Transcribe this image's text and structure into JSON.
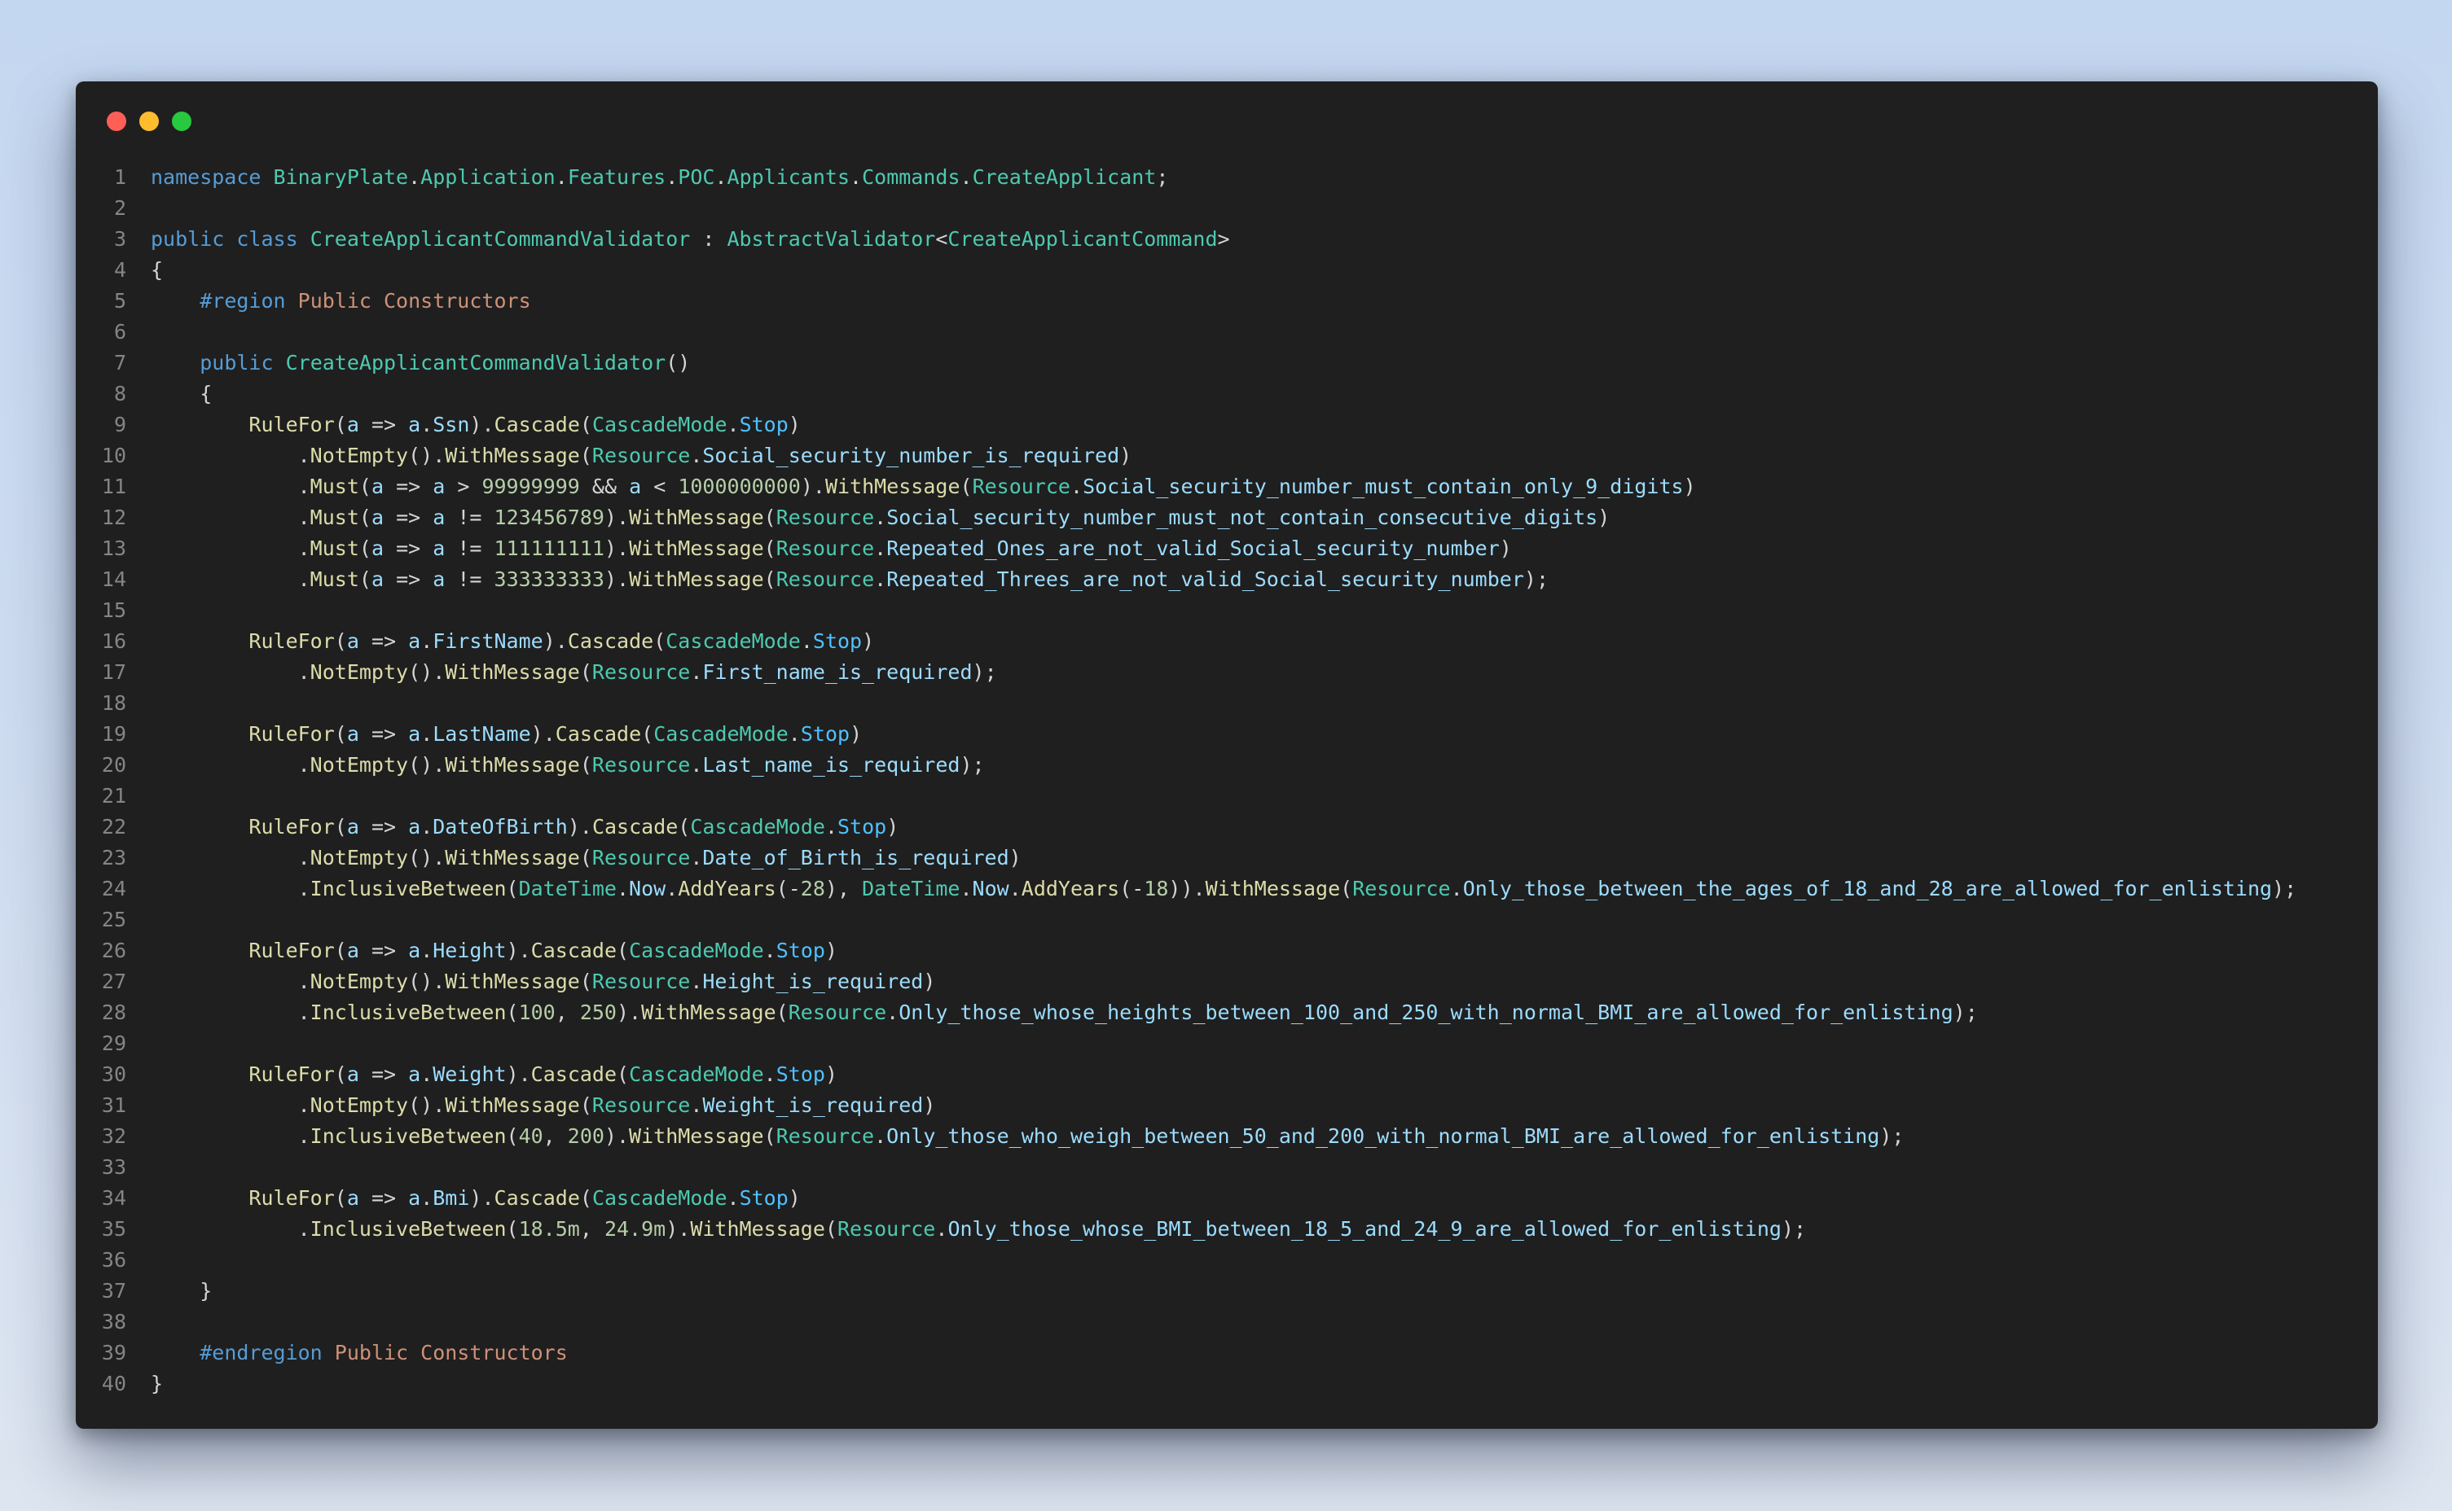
{
  "window": {
    "controls": [
      "close",
      "minimize",
      "maximize"
    ],
    "colors": {
      "background": "#1f1f1f",
      "keyword": "#569cd6",
      "type": "#4ec9b0",
      "method": "#dcdcaa",
      "property": "#9cdcfe",
      "enum_member": "#4fc1ff",
      "number": "#b5cea8",
      "region_text": "#ce9178",
      "line_number": "#858585"
    }
  },
  "code": {
    "language": "csharp",
    "lines": [
      [
        [
          "kw",
          "namespace"
        ],
        [
          "p",
          " "
        ],
        [
          "t",
          "BinaryPlate"
        ],
        [
          "p",
          "."
        ],
        [
          "t",
          "Application"
        ],
        [
          "p",
          "."
        ],
        [
          "t",
          "Features"
        ],
        [
          "p",
          "."
        ],
        [
          "t",
          "POC"
        ],
        [
          "p",
          "."
        ],
        [
          "t",
          "Applicants"
        ],
        [
          "p",
          "."
        ],
        [
          "t",
          "Commands"
        ],
        [
          "p",
          "."
        ],
        [
          "t",
          "CreateApplicant"
        ],
        [
          "p",
          ";"
        ]
      ],
      [],
      [
        [
          "kw",
          "public"
        ],
        [
          "p",
          " "
        ],
        [
          "kw",
          "class"
        ],
        [
          "p",
          " "
        ],
        [
          "t",
          "CreateApplicantCommandValidator"
        ],
        [
          "p",
          " : "
        ],
        [
          "t",
          "AbstractValidator"
        ],
        [
          "p",
          "<"
        ],
        [
          "t",
          "CreateApplicantCommand"
        ],
        [
          "p",
          ">"
        ]
      ],
      [
        [
          "p",
          "{"
        ]
      ],
      [
        [
          "p",
          "    "
        ],
        [
          "kw",
          "#region"
        ],
        [
          "p",
          " "
        ],
        [
          "r",
          "Public Constructors"
        ]
      ],
      [],
      [
        [
          "p",
          "    "
        ],
        [
          "kw",
          "public"
        ],
        [
          "p",
          " "
        ],
        [
          "t",
          "CreateApplicantCommandValidator"
        ],
        [
          "p",
          "()"
        ]
      ],
      [
        [
          "p",
          "    {"
        ]
      ],
      [
        [
          "p",
          "        "
        ],
        [
          "m",
          "RuleFor"
        ],
        [
          "p",
          "("
        ],
        [
          "pr",
          "a"
        ],
        [
          "p",
          " => "
        ],
        [
          "pr",
          "a"
        ],
        [
          "p",
          "."
        ],
        [
          "pr",
          "Ssn"
        ],
        [
          "p",
          ")."
        ],
        [
          "m",
          "Cascade"
        ],
        [
          "p",
          "("
        ],
        [
          "t",
          "CascadeMode"
        ],
        [
          "p",
          "."
        ],
        [
          "e",
          "Stop"
        ],
        [
          "p",
          ")"
        ]
      ],
      [
        [
          "p",
          "            ."
        ],
        [
          "m",
          "NotEmpty"
        ],
        [
          "p",
          "()."
        ],
        [
          "m",
          "WithMessage"
        ],
        [
          "p",
          "("
        ],
        [
          "t",
          "Resource"
        ],
        [
          "p",
          "."
        ],
        [
          "pr",
          "Social_security_number_is_required"
        ],
        [
          "p",
          ")"
        ]
      ],
      [
        [
          "p",
          "            ."
        ],
        [
          "m",
          "Must"
        ],
        [
          "p",
          "("
        ],
        [
          "pr",
          "a"
        ],
        [
          "p",
          " => "
        ],
        [
          "pr",
          "a"
        ],
        [
          "p",
          " > "
        ],
        [
          "n",
          "99999999"
        ],
        [
          "p",
          " && "
        ],
        [
          "pr",
          "a"
        ],
        [
          "p",
          " < "
        ],
        [
          "n",
          "1000000000"
        ],
        [
          "p",
          ")."
        ],
        [
          "m",
          "WithMessage"
        ],
        [
          "p",
          "("
        ],
        [
          "t",
          "Resource"
        ],
        [
          "p",
          "."
        ],
        [
          "pr",
          "Social_security_number_must_contain_only_9_digits"
        ],
        [
          "p",
          ")"
        ]
      ],
      [
        [
          "p",
          "            ."
        ],
        [
          "m",
          "Must"
        ],
        [
          "p",
          "("
        ],
        [
          "pr",
          "a"
        ],
        [
          "p",
          " => "
        ],
        [
          "pr",
          "a"
        ],
        [
          "p",
          " != "
        ],
        [
          "n",
          "123456789"
        ],
        [
          "p",
          ")."
        ],
        [
          "m",
          "WithMessage"
        ],
        [
          "p",
          "("
        ],
        [
          "t",
          "Resource"
        ],
        [
          "p",
          "."
        ],
        [
          "pr",
          "Social_security_number_must_not_contain_consecutive_digits"
        ],
        [
          "p",
          ")"
        ]
      ],
      [
        [
          "p",
          "            ."
        ],
        [
          "m",
          "Must"
        ],
        [
          "p",
          "("
        ],
        [
          "pr",
          "a"
        ],
        [
          "p",
          " => "
        ],
        [
          "pr",
          "a"
        ],
        [
          "p",
          " != "
        ],
        [
          "n",
          "111111111"
        ],
        [
          "p",
          ")."
        ],
        [
          "m",
          "WithMessage"
        ],
        [
          "p",
          "("
        ],
        [
          "t",
          "Resource"
        ],
        [
          "p",
          "."
        ],
        [
          "pr",
          "Repeated_Ones_are_not_valid_Social_security_number"
        ],
        [
          "p",
          ")"
        ]
      ],
      [
        [
          "p",
          "            ."
        ],
        [
          "m",
          "Must"
        ],
        [
          "p",
          "("
        ],
        [
          "pr",
          "a"
        ],
        [
          "p",
          " => "
        ],
        [
          "pr",
          "a"
        ],
        [
          "p",
          " != "
        ],
        [
          "n",
          "333333333"
        ],
        [
          "p",
          ")."
        ],
        [
          "m",
          "WithMessage"
        ],
        [
          "p",
          "("
        ],
        [
          "t",
          "Resource"
        ],
        [
          "p",
          "."
        ],
        [
          "pr",
          "Repeated_Threes_are_not_valid_Social_security_number"
        ],
        [
          "p",
          ");"
        ]
      ],
      [],
      [
        [
          "p",
          "        "
        ],
        [
          "m",
          "RuleFor"
        ],
        [
          "p",
          "("
        ],
        [
          "pr",
          "a"
        ],
        [
          "p",
          " => "
        ],
        [
          "pr",
          "a"
        ],
        [
          "p",
          "."
        ],
        [
          "pr",
          "FirstName"
        ],
        [
          "p",
          ")."
        ],
        [
          "m",
          "Cascade"
        ],
        [
          "p",
          "("
        ],
        [
          "t",
          "CascadeMode"
        ],
        [
          "p",
          "."
        ],
        [
          "e",
          "Stop"
        ],
        [
          "p",
          ")"
        ]
      ],
      [
        [
          "p",
          "            ."
        ],
        [
          "m",
          "NotEmpty"
        ],
        [
          "p",
          "()."
        ],
        [
          "m",
          "WithMessage"
        ],
        [
          "p",
          "("
        ],
        [
          "t",
          "Resource"
        ],
        [
          "p",
          "."
        ],
        [
          "pr",
          "First_name_is_required"
        ],
        [
          "p",
          ");"
        ]
      ],
      [],
      [
        [
          "p",
          "        "
        ],
        [
          "m",
          "RuleFor"
        ],
        [
          "p",
          "("
        ],
        [
          "pr",
          "a"
        ],
        [
          "p",
          " => "
        ],
        [
          "pr",
          "a"
        ],
        [
          "p",
          "."
        ],
        [
          "pr",
          "LastName"
        ],
        [
          "p",
          ")."
        ],
        [
          "m",
          "Cascade"
        ],
        [
          "p",
          "("
        ],
        [
          "t",
          "CascadeMode"
        ],
        [
          "p",
          "."
        ],
        [
          "e",
          "Stop"
        ],
        [
          "p",
          ")"
        ]
      ],
      [
        [
          "p",
          "            ."
        ],
        [
          "m",
          "NotEmpty"
        ],
        [
          "p",
          "()."
        ],
        [
          "m",
          "WithMessage"
        ],
        [
          "p",
          "("
        ],
        [
          "t",
          "Resource"
        ],
        [
          "p",
          "."
        ],
        [
          "pr",
          "Last_name_is_required"
        ],
        [
          "p",
          ");"
        ]
      ],
      [],
      [
        [
          "p",
          "        "
        ],
        [
          "m",
          "RuleFor"
        ],
        [
          "p",
          "("
        ],
        [
          "pr",
          "a"
        ],
        [
          "p",
          " => "
        ],
        [
          "pr",
          "a"
        ],
        [
          "p",
          "."
        ],
        [
          "pr",
          "DateOfBirth"
        ],
        [
          "p",
          ")."
        ],
        [
          "m",
          "Cascade"
        ],
        [
          "p",
          "("
        ],
        [
          "t",
          "CascadeMode"
        ],
        [
          "p",
          "."
        ],
        [
          "e",
          "Stop"
        ],
        [
          "p",
          ")"
        ]
      ],
      [
        [
          "p",
          "            ."
        ],
        [
          "m",
          "NotEmpty"
        ],
        [
          "p",
          "()."
        ],
        [
          "m",
          "WithMessage"
        ],
        [
          "p",
          "("
        ],
        [
          "t",
          "Resource"
        ],
        [
          "p",
          "."
        ],
        [
          "pr",
          "Date_of_Birth_is_required"
        ],
        [
          "p",
          ")"
        ]
      ],
      [
        [
          "p",
          "            ."
        ],
        [
          "m",
          "InclusiveBetween"
        ],
        [
          "p",
          "("
        ],
        [
          "t",
          "DateTime"
        ],
        [
          "p",
          "."
        ],
        [
          "pr",
          "Now"
        ],
        [
          "p",
          "."
        ],
        [
          "m",
          "AddYears"
        ],
        [
          "p",
          "(-"
        ],
        [
          "n",
          "28"
        ],
        [
          "p",
          "), "
        ],
        [
          "t",
          "DateTime"
        ],
        [
          "p",
          "."
        ],
        [
          "pr",
          "Now"
        ],
        [
          "p",
          "."
        ],
        [
          "m",
          "AddYears"
        ],
        [
          "p",
          "(-"
        ],
        [
          "n",
          "18"
        ],
        [
          "p",
          "))."
        ],
        [
          "m",
          "WithMessage"
        ],
        [
          "p",
          "("
        ],
        [
          "t",
          "Resource"
        ],
        [
          "p",
          "."
        ],
        [
          "pr",
          "Only_those_between_the_ages_of_18_and_28_are_allowed_for_enlisting"
        ],
        [
          "p",
          ");"
        ]
      ],
      [],
      [
        [
          "p",
          "        "
        ],
        [
          "m",
          "RuleFor"
        ],
        [
          "p",
          "("
        ],
        [
          "pr",
          "a"
        ],
        [
          "p",
          " => "
        ],
        [
          "pr",
          "a"
        ],
        [
          "p",
          "."
        ],
        [
          "pr",
          "Height"
        ],
        [
          "p",
          ")."
        ],
        [
          "m",
          "Cascade"
        ],
        [
          "p",
          "("
        ],
        [
          "t",
          "CascadeMode"
        ],
        [
          "p",
          "."
        ],
        [
          "e",
          "Stop"
        ],
        [
          "p",
          ")"
        ]
      ],
      [
        [
          "p",
          "            ."
        ],
        [
          "m",
          "NotEmpty"
        ],
        [
          "p",
          "()."
        ],
        [
          "m",
          "WithMessage"
        ],
        [
          "p",
          "("
        ],
        [
          "t",
          "Resource"
        ],
        [
          "p",
          "."
        ],
        [
          "pr",
          "Height_is_required"
        ],
        [
          "p",
          ")"
        ]
      ],
      [
        [
          "p",
          "            ."
        ],
        [
          "m",
          "InclusiveBetween"
        ],
        [
          "p",
          "("
        ],
        [
          "n",
          "100"
        ],
        [
          "p",
          ", "
        ],
        [
          "n",
          "250"
        ],
        [
          "p",
          ")."
        ],
        [
          "m",
          "WithMessage"
        ],
        [
          "p",
          "("
        ],
        [
          "t",
          "Resource"
        ],
        [
          "p",
          "."
        ],
        [
          "pr",
          "Only_those_whose_heights_between_100_and_250_with_normal_BMI_are_allowed_for_enlisting"
        ],
        [
          "p",
          ");"
        ]
      ],
      [],
      [
        [
          "p",
          "        "
        ],
        [
          "m",
          "RuleFor"
        ],
        [
          "p",
          "("
        ],
        [
          "pr",
          "a"
        ],
        [
          "p",
          " => "
        ],
        [
          "pr",
          "a"
        ],
        [
          "p",
          "."
        ],
        [
          "pr",
          "Weight"
        ],
        [
          "p",
          ")."
        ],
        [
          "m",
          "Cascade"
        ],
        [
          "p",
          "("
        ],
        [
          "t",
          "CascadeMode"
        ],
        [
          "p",
          "."
        ],
        [
          "e",
          "Stop"
        ],
        [
          "p",
          ")"
        ]
      ],
      [
        [
          "p",
          "            ."
        ],
        [
          "m",
          "NotEmpty"
        ],
        [
          "p",
          "()."
        ],
        [
          "m",
          "WithMessage"
        ],
        [
          "p",
          "("
        ],
        [
          "t",
          "Resource"
        ],
        [
          "p",
          "."
        ],
        [
          "pr",
          "Weight_is_required"
        ],
        [
          "p",
          ")"
        ]
      ],
      [
        [
          "p",
          "            ."
        ],
        [
          "m",
          "InclusiveBetween"
        ],
        [
          "p",
          "("
        ],
        [
          "n",
          "40"
        ],
        [
          "p",
          ", "
        ],
        [
          "n",
          "200"
        ],
        [
          "p",
          ")."
        ],
        [
          "m",
          "WithMessage"
        ],
        [
          "p",
          "("
        ],
        [
          "t",
          "Resource"
        ],
        [
          "p",
          "."
        ],
        [
          "pr",
          "Only_those_who_weigh_between_50_and_200_with_normal_BMI_are_allowed_for_enlisting"
        ],
        [
          "p",
          ");"
        ]
      ],
      [],
      [
        [
          "p",
          "        "
        ],
        [
          "m",
          "RuleFor"
        ],
        [
          "p",
          "("
        ],
        [
          "pr",
          "a"
        ],
        [
          "p",
          " => "
        ],
        [
          "pr",
          "a"
        ],
        [
          "p",
          "."
        ],
        [
          "pr",
          "Bmi"
        ],
        [
          "p",
          ")."
        ],
        [
          "m",
          "Cascade"
        ],
        [
          "p",
          "("
        ],
        [
          "t",
          "CascadeMode"
        ],
        [
          "p",
          "."
        ],
        [
          "e",
          "Stop"
        ],
        [
          "p",
          ")"
        ]
      ],
      [
        [
          "p",
          "            ."
        ],
        [
          "m",
          "InclusiveBetween"
        ],
        [
          "p",
          "("
        ],
        [
          "n",
          "18.5m"
        ],
        [
          "p",
          ", "
        ],
        [
          "n",
          "24.9m"
        ],
        [
          "p",
          ")."
        ],
        [
          "m",
          "WithMessage"
        ],
        [
          "p",
          "("
        ],
        [
          "t",
          "Resource"
        ],
        [
          "p",
          "."
        ],
        [
          "pr",
          "Only_those_whose_BMI_between_18_5_and_24_9_are_allowed_for_enlisting"
        ],
        [
          "p",
          ");"
        ]
      ],
      [],
      [
        [
          "p",
          "    }"
        ]
      ],
      [],
      [
        [
          "p",
          "    "
        ],
        [
          "kw",
          "#endregion"
        ],
        [
          "p",
          " "
        ],
        [
          "r",
          "Public Constructors"
        ]
      ],
      [
        [
          "p",
          "}"
        ]
      ]
    ]
  }
}
